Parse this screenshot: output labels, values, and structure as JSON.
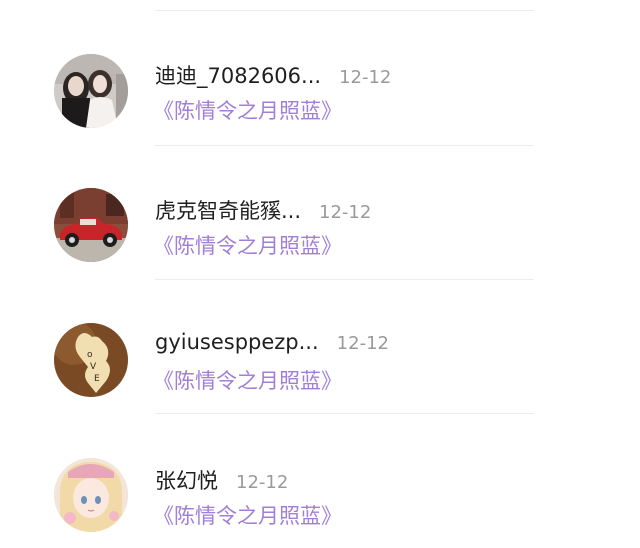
{
  "items": [
    {
      "name": "迪迪_7082606...",
      "time": "12-12",
      "link": "《陈情令之月照蓝》",
      "avatar": "girl-photo-avatar"
    },
    {
      "name": "虎克智奇能豯...",
      "time": "12-12",
      "link": "《陈情令之月照蓝》",
      "avatar": "red-car-avatar"
    },
    {
      "name": "gyiusesppezp...",
      "time": "12-12",
      "link": "《陈情令之月照蓝》",
      "avatar": "love-heart-avatar"
    },
    {
      "name": "张幻悦",
      "time": "12-12",
      "link": "《陈情令之月照蓝》",
      "avatar": "anime-girl-avatar"
    }
  ]
}
